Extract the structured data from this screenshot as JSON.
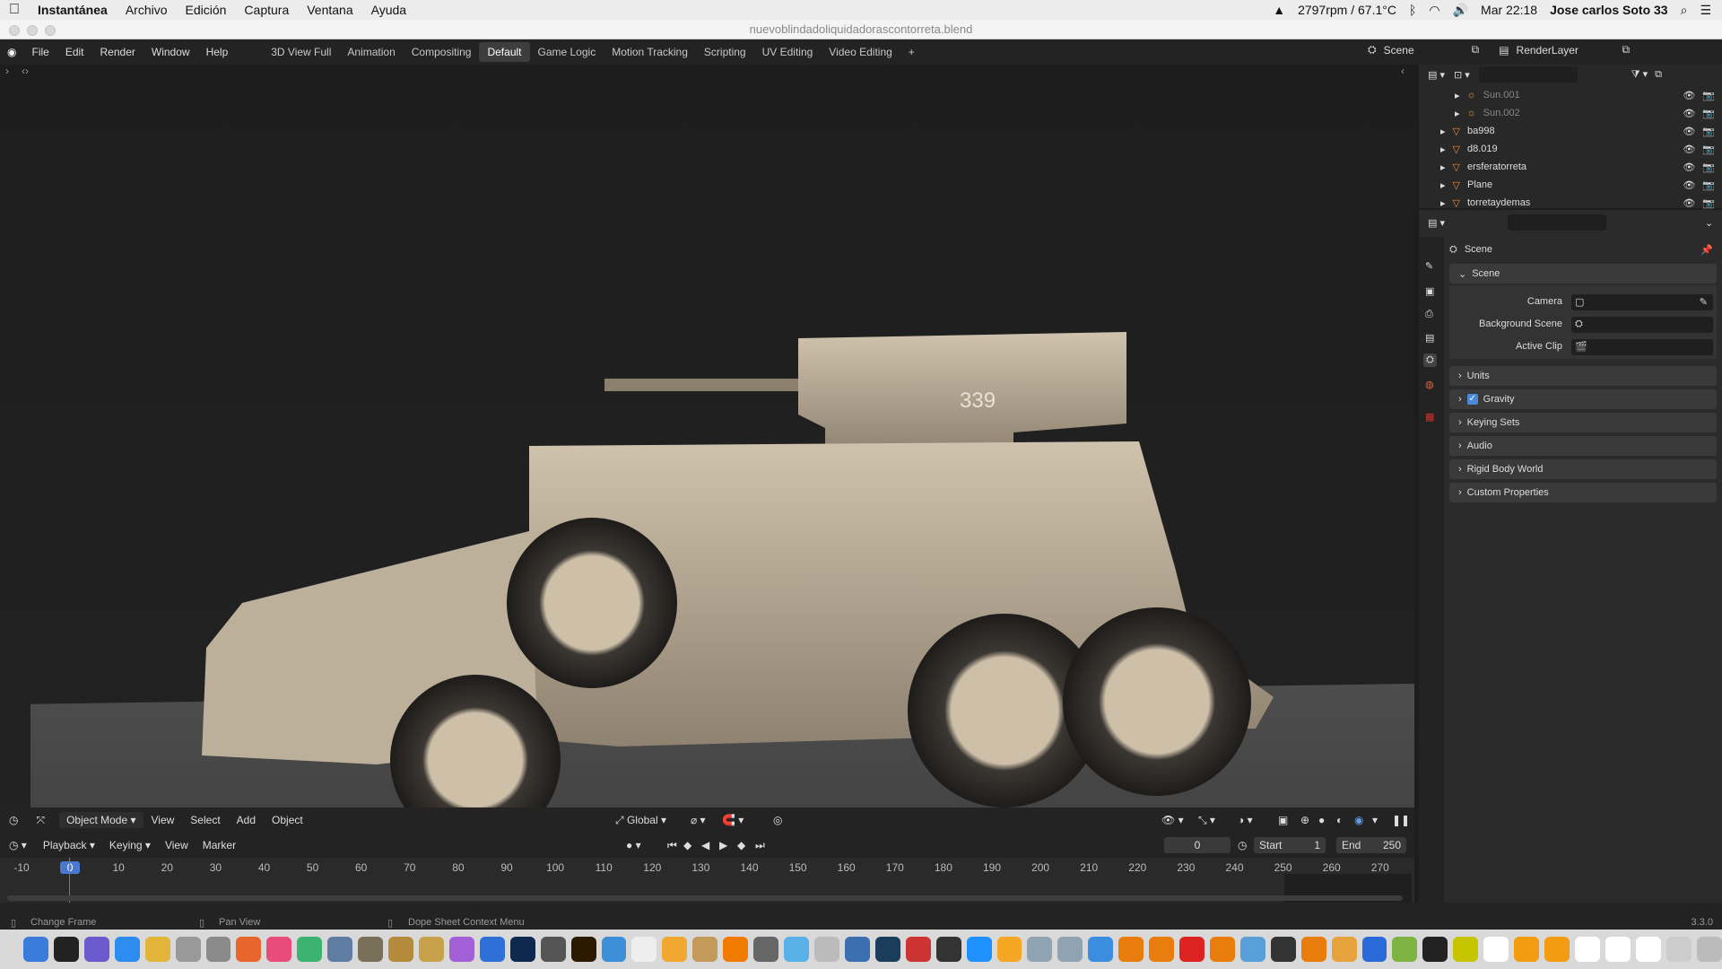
{
  "mac": {
    "app_name": "Instantánea",
    "menus": [
      "Archivo",
      "Edición",
      "Captura",
      "Ventana",
      "Ayuda"
    ],
    "status": "2797rpm / 67.1°C",
    "clock": "Mar 22:18",
    "user": "Jose carlos Soto 33"
  },
  "window": {
    "title": "nuevoblindadoliquidadorascontorreta.blend"
  },
  "blender": {
    "menus": [
      "File",
      "Edit",
      "Render",
      "Window",
      "Help"
    ],
    "workspaces": [
      "3D View Full",
      "Animation",
      "Compositing",
      "Default",
      "Game Logic",
      "Motion Tracking",
      "Scripting",
      "UV Editing",
      "Video Editing"
    ],
    "active_workspace": "Default",
    "scene": "Scene",
    "view_layer": "RenderLayer"
  },
  "outliner": {
    "items": [
      {
        "name": "Sun.001"
      },
      {
        "name": "Sun.002"
      },
      {
        "name": "ba998"
      },
      {
        "name": "d8.019"
      },
      {
        "name": "ersferatorreta"
      },
      {
        "name": "Plane"
      },
      {
        "name": "torretaydemas"
      }
    ]
  },
  "properties": {
    "header": "Scene",
    "panel_scene": "Scene",
    "camera_label": "Camera",
    "bg_scene_label": "Background Scene",
    "active_clip_label": "Active Clip",
    "panels": [
      "Units",
      "Gravity",
      "Keying Sets",
      "Audio",
      "Rigid Body World",
      "Custom Properties"
    ],
    "gravity_checked": true
  },
  "viewport": {
    "mode": "Object Mode",
    "menus": [
      "View",
      "Select",
      "Add",
      "Object"
    ],
    "orientation": "Global",
    "turret_number": "339"
  },
  "timeline": {
    "menus": [
      "Playback",
      "Keying",
      "View",
      "Marker"
    ],
    "current_frame": "0",
    "start_label": "Start",
    "start": "1",
    "end_label": "End",
    "end": "250",
    "ticks": [
      "-10",
      "0",
      "10",
      "20",
      "30",
      "40",
      "50",
      "60",
      "70",
      "80",
      "90",
      "100",
      "110",
      "120",
      "130",
      "140",
      "150",
      "160",
      "170",
      "180",
      "190",
      "200",
      "210",
      "220",
      "230",
      "240",
      "250",
      "260",
      "270"
    ]
  },
  "status": {
    "left": "Change Frame",
    "mid": "Pan View",
    "right": "Dope Sheet Context Menu",
    "version": "3.3.0"
  }
}
